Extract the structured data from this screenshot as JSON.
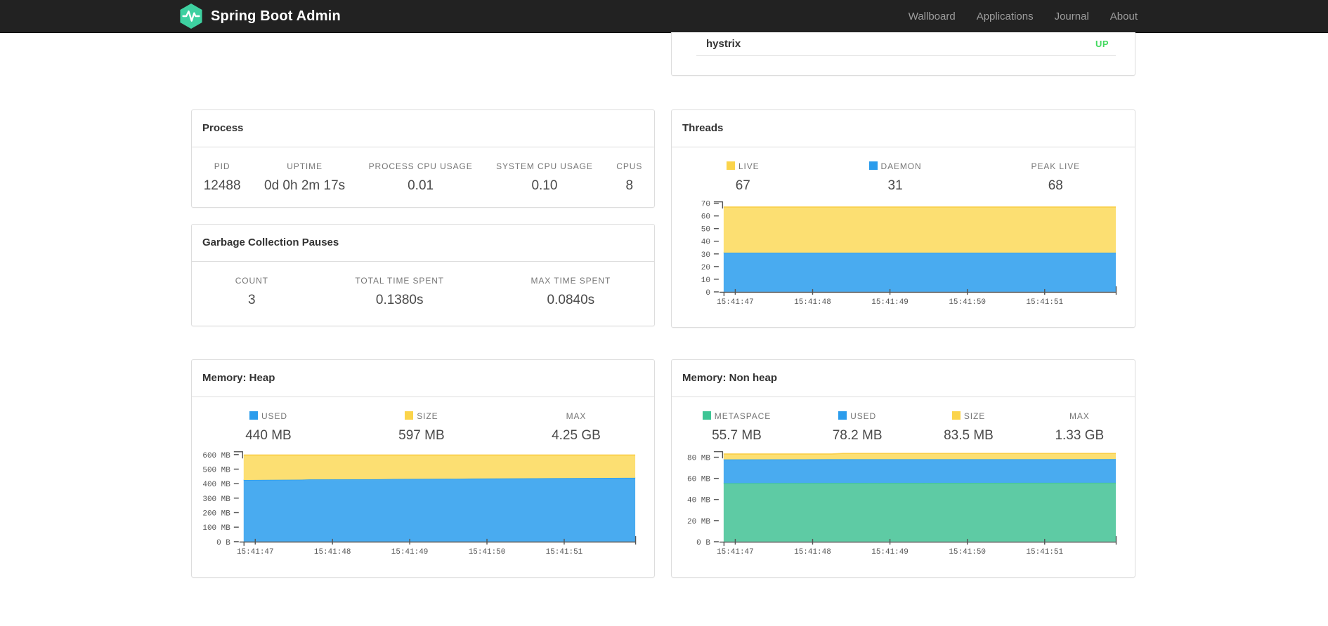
{
  "navbar": {
    "brand": "Spring Boot Admin",
    "links": [
      "Wallboard",
      "Applications",
      "Journal",
      "About"
    ]
  },
  "colors": {
    "navbar_bg": "#222222",
    "nav_link": "#9d9d9d",
    "logo_green": "#3ed0a0",
    "status_up": "#42d95f",
    "chart_blue": "#2b9cec",
    "chart_yellow": "#fbd44b",
    "chart_green": "#3ec595"
  },
  "application": {
    "name": "hystrix",
    "status": "UP",
    "status_color": "#42d95f"
  },
  "panels": {
    "process": {
      "title": "Process",
      "stats": [
        {
          "label": "PID",
          "value": "12488"
        },
        {
          "label": "UPTIME",
          "value": "0d 0h 2m 17s"
        },
        {
          "label": "PROCESS CPU USAGE",
          "value": "0.01"
        },
        {
          "label": "SYSTEM CPU USAGE",
          "value": "0.10"
        },
        {
          "label": "CPUS",
          "value": "8"
        }
      ]
    },
    "gc": {
      "title": "Garbage Collection Pauses",
      "stats": [
        {
          "label": "COUNT",
          "value": "3"
        },
        {
          "label": "TOTAL TIME SPENT",
          "value": "0.1380s"
        },
        {
          "label": "MAX TIME SPENT",
          "value": "0.0840s"
        }
      ]
    },
    "threads": {
      "title": "Threads",
      "stats": [
        {
          "label": "LIVE",
          "value": "67",
          "swatch": "#fbd44b"
        },
        {
          "label": "DAEMON",
          "value": "31",
          "swatch": "#2b9cec"
        },
        {
          "label": "PEAK LIVE",
          "value": "68"
        }
      ]
    },
    "heap": {
      "title": "Memory: Heap",
      "stats": [
        {
          "label": "USED",
          "value": "440 MB",
          "swatch": "#2b9cec"
        },
        {
          "label": "SIZE",
          "value": "597 MB",
          "swatch": "#fbd44b"
        },
        {
          "label": "MAX",
          "value": "4.25 GB"
        }
      ]
    },
    "nonheap": {
      "title": "Memory: Non heap",
      "stats": [
        {
          "label": "METASPACE",
          "value": "55.7 MB",
          "swatch": "#3ec595"
        },
        {
          "label": "USED",
          "value": "78.2 MB",
          "swatch": "#2b9cec"
        },
        {
          "label": "SIZE",
          "value": "83.5 MB",
          "swatch": "#fbd44b"
        },
        {
          "label": "MAX",
          "value": "1.33 GB"
        }
      ]
    }
  },
  "chart_data": [
    {
      "id": "threads",
      "type": "area",
      "stacked": true,
      "title": "Threads",
      "x_type": "time",
      "xmin": 46.85,
      "xmax": 51.92,
      "xticks": [
        {
          "v": 47,
          "label": "15:41:47"
        },
        {
          "v": 48,
          "label": "15:41:48"
        },
        {
          "v": 49,
          "label": "15:41:49"
        },
        {
          "v": 50,
          "label": "15:41:50"
        },
        {
          "v": 51,
          "label": "15:41:51"
        }
      ],
      "ymax": 71.4,
      "yticks": [
        {
          "v": 0,
          "label": "0"
        },
        {
          "v": 10,
          "label": "10"
        },
        {
          "v": 20,
          "label": "20"
        },
        {
          "v": 30,
          "label": "30"
        },
        {
          "v": 40,
          "label": "40"
        },
        {
          "v": 50,
          "label": "50"
        },
        {
          "v": 60,
          "label": "60"
        },
        {
          "v": 70,
          "label": "70"
        }
      ],
      "series": [
        {
          "name": "DAEMON",
          "fill": "#49abf0",
          "line": "#2b9cec",
          "tops": [
            [
              46.85,
              31
            ],
            [
              51.92,
              31
            ]
          ]
        },
        {
          "name": "LIVE",
          "fill": "#fcdf72",
          "line": "#f9ce45",
          "tops": [
            [
              46.85,
              67
            ],
            [
              51.92,
              67
            ]
          ]
        }
      ]
    },
    {
      "id": "heap",
      "type": "area",
      "stacked": true,
      "title": "Memory: Heap",
      "x_type": "time",
      "xmin": 46.85,
      "xmax": 51.92,
      "xticks": [
        {
          "v": 47,
          "label": "15:41:47"
        },
        {
          "v": 48,
          "label": "15:41:48"
        },
        {
          "v": 49,
          "label": "15:41:49"
        },
        {
          "v": 50,
          "label": "15:41:50"
        },
        {
          "v": 51,
          "label": "15:41:51"
        }
      ],
      "ymax": 622,
      "yticks": [
        {
          "v": 0,
          "label": "0 B"
        },
        {
          "v": 100,
          "label": "100 MB"
        },
        {
          "v": 200,
          "label": "200 MB"
        },
        {
          "v": 300,
          "label": "300 MB"
        },
        {
          "v": 400,
          "label": "400 MB"
        },
        {
          "v": 500,
          "label": "500 MB"
        },
        {
          "v": 600,
          "label": "600 MB"
        }
      ],
      "series": [
        {
          "name": "USED",
          "fill": "#49abf0",
          "line": "#2b9cec",
          "tops": [
            [
              46.85,
              425
            ],
            [
              47.6,
              427
            ],
            [
              47.7,
              429
            ],
            [
              48.6,
              430
            ],
            [
              48.8,
              432
            ],
            [
              49.6,
              434
            ],
            [
              49.8,
              435
            ],
            [
              50.6,
              437
            ],
            [
              50.8,
              438
            ],
            [
              51.4,
              439
            ],
            [
              51.92,
              440
            ]
          ]
        },
        {
          "name": "SIZE",
          "fill": "#fcdf72",
          "line": "#f9ce45",
          "tops": [
            [
              46.85,
              597
            ],
            [
              51.92,
              597
            ]
          ]
        }
      ]
    },
    {
      "id": "nonheap",
      "type": "area",
      "stacked": true,
      "title": "Memory: Non heap",
      "x_type": "time",
      "xmin": 46.85,
      "xmax": 51.92,
      "xticks": [
        {
          "v": 47,
          "label": "15:41:47"
        },
        {
          "v": 48,
          "label": "15:41:48"
        },
        {
          "v": 49,
          "label": "15:41:49"
        },
        {
          "v": 50,
          "label": "15:41:50"
        },
        {
          "v": 51,
          "label": "15:41:51"
        }
      ],
      "ymax": 85.6,
      "yticks": [
        {
          "v": 0,
          "label": "0 B"
        },
        {
          "v": 20,
          "label": "20 MB"
        },
        {
          "v": 40,
          "label": "40 MB"
        },
        {
          "v": 60,
          "label": "60 MB"
        },
        {
          "v": 80,
          "label": "80 MB"
        }
      ],
      "series": [
        {
          "name": "METASPACE",
          "fill": "#5ecba4",
          "line": "#3ec593",
          "tops": [
            [
              46.85,
              55.5
            ],
            [
              49.0,
              55.7
            ],
            [
              51.92,
              55.9
            ]
          ]
        },
        {
          "name": "USED",
          "fill": "#49abf0",
          "line": "#2b9cec",
          "tops": [
            [
              46.85,
              78.0
            ],
            [
              48.2,
              78.1
            ],
            [
              51.92,
              78.2
            ]
          ]
        },
        {
          "name": "SIZE",
          "fill": "#fcdf72",
          "line": "#f9ce45",
          "tops": [
            [
              46.85,
              83.1
            ],
            [
              48.25,
              83.1
            ],
            [
              48.4,
              83.6
            ],
            [
              51.92,
              83.6
            ]
          ]
        }
      ]
    }
  ]
}
